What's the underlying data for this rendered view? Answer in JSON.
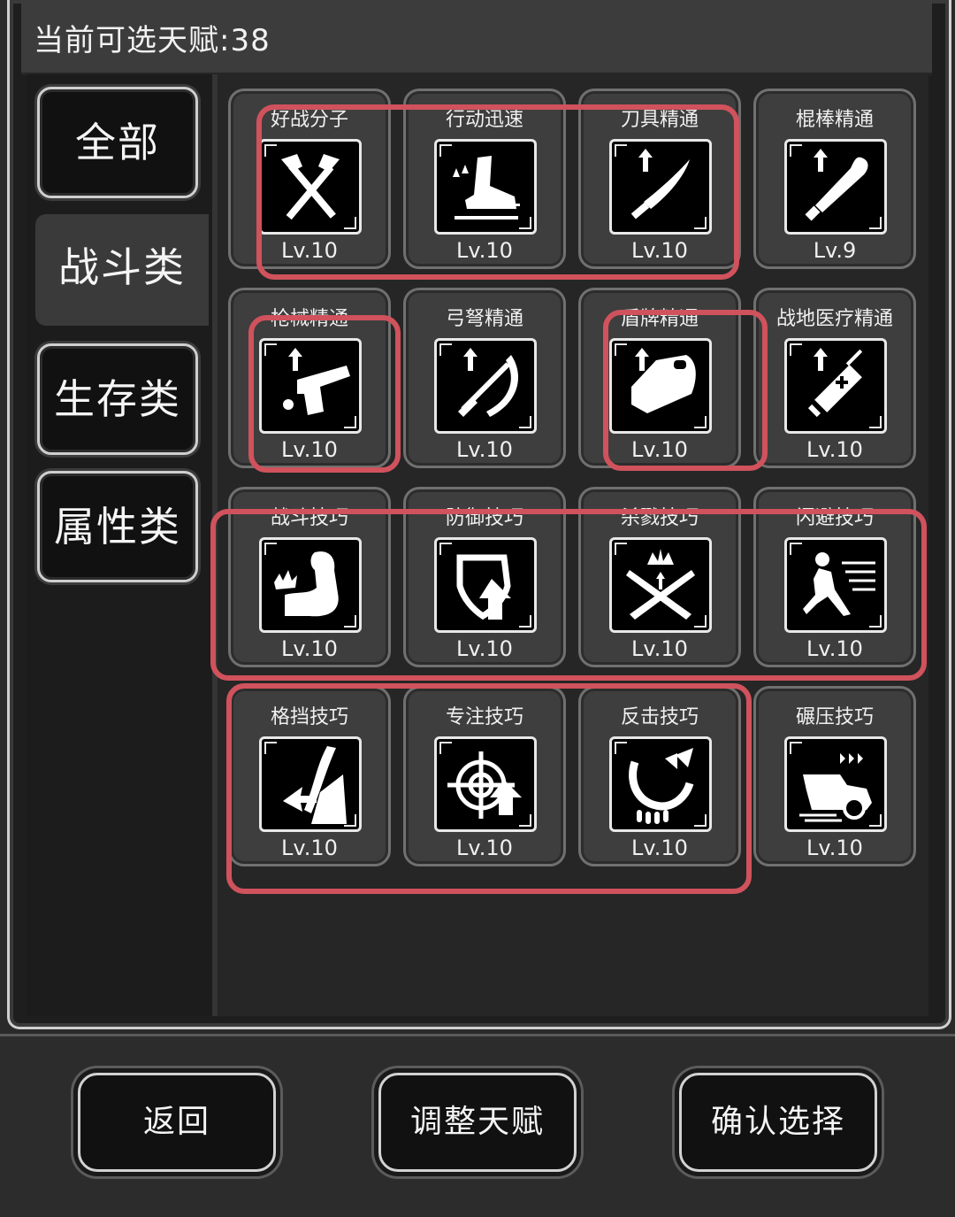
{
  "header": {
    "available_label": "当前可选天赋:38"
  },
  "categories": [
    {
      "label": "全部",
      "active": false
    },
    {
      "label": "战斗类",
      "active": true
    },
    {
      "label": "生存类",
      "active": false
    },
    {
      "label": "属性类",
      "active": false
    }
  ],
  "talents": [
    {
      "name": "好战分子",
      "level": "Lv.10",
      "icon": "crossed-axes-icon"
    },
    {
      "name": "行动迅速",
      "level": "Lv.10",
      "icon": "fast-foot-icon"
    },
    {
      "name": "刀具精通",
      "level": "Lv.10",
      "icon": "knife-icon"
    },
    {
      "name": "棍棒精通",
      "level": "Lv.9",
      "icon": "bat-icon"
    },
    {
      "name": "枪械精通",
      "level": "Lv.10",
      "icon": "pistol-icon"
    },
    {
      "name": "弓弩精通",
      "level": "Lv.10",
      "icon": "crossbow-icon"
    },
    {
      "name": "盾牌精通",
      "level": "Lv.10",
      "icon": "shield-icon"
    },
    {
      "name": "战地医疗精通",
      "level": "Lv.10",
      "icon": "syringe-icon"
    },
    {
      "name": "战斗技巧",
      "level": "Lv.10",
      "icon": "flexed-arm-icon"
    },
    {
      "name": "防御技巧",
      "level": "Lv.10",
      "icon": "defense-shield-icon"
    },
    {
      "name": "杀戮技巧",
      "level": "Lv.10",
      "icon": "crossed-blades-icon"
    },
    {
      "name": "闪避技巧",
      "level": "Lv.10",
      "icon": "dodge-runner-icon"
    },
    {
      "name": "格挡技巧",
      "level": "Lv.10",
      "icon": "parry-icon"
    },
    {
      "name": "专注技巧",
      "level": "Lv.10",
      "icon": "crosshair-icon"
    },
    {
      "name": "反击技巧",
      "level": "Lv.10",
      "icon": "counter-claw-icon"
    },
    {
      "name": "碾压技巧",
      "level": "Lv.10",
      "icon": "car-ram-icon"
    }
  ],
  "actions": {
    "back": "返回",
    "adjust": "调整天赋",
    "confirm": "确认选择"
  },
  "highlight_color": "#d0525c"
}
